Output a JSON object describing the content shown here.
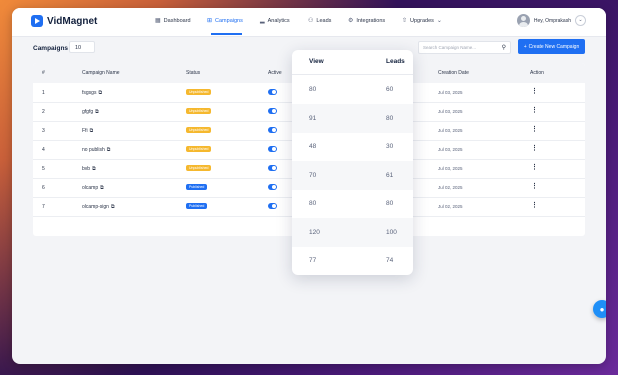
{
  "brand": {
    "name": "VidMagnet"
  },
  "nav": [
    {
      "label": "Dashboard",
      "icon": "grid-icon"
    },
    {
      "label": "Campaigns",
      "icon": "campaign-icon"
    },
    {
      "label": "Analytics",
      "icon": "bar-chart-icon"
    },
    {
      "label": "Leads",
      "icon": "users-icon"
    },
    {
      "label": "Integrations",
      "icon": "gear-icon"
    },
    {
      "label": "Upgrades",
      "icon": "upgrade-icon"
    }
  ],
  "user": {
    "greeting": "Hey, Omprakash"
  },
  "toolbar": {
    "title": "Campaigns",
    "count": "10",
    "search_placeholder": "Search Campaign Name...",
    "new_button": "Create New Campaign"
  },
  "table": {
    "headers": {
      "num": "#",
      "name": "Campaign Name",
      "status": "Status",
      "active": "Active",
      "created": "Creation Date",
      "action": "Action"
    },
    "rows": [
      {
        "num": "1",
        "name": "fsgsgs",
        "status": "Unpublished",
        "status_type": "unpublished",
        "active": true,
        "created": "Jul 03, 2025"
      },
      {
        "num": "2",
        "name": "gfgfg",
        "status": "Unpublished",
        "status_type": "unpublished",
        "active": true,
        "created": "Jul 03, 2025"
      },
      {
        "num": "3",
        "name": "Ffi",
        "status": "Unpublished",
        "status_type": "unpublished",
        "active": true,
        "created": "Jul 03, 2025"
      },
      {
        "num": "4",
        "name": "no publish",
        "status": "Unpublished",
        "status_type": "unpublished",
        "active": true,
        "created": "Jul 03, 2025"
      },
      {
        "num": "5",
        "name": "bvb",
        "status": "Unpublished",
        "status_type": "unpublished",
        "active": true,
        "created": "Jul 03, 2025"
      },
      {
        "num": "6",
        "name": "olcamp",
        "status": "Published",
        "status_type": "published",
        "active": true,
        "created": "Jul 02, 2025"
      },
      {
        "num": "7",
        "name": "olcamp-sign",
        "status": "Published",
        "status_type": "published",
        "active": true,
        "created": "Jul 02, 2025"
      }
    ]
  },
  "popup": {
    "headers": {
      "view": "View",
      "leads": "Leads"
    },
    "rows": [
      {
        "view": "80",
        "leads": "60"
      },
      {
        "view": "91",
        "leads": "80"
      },
      {
        "view": "48",
        "leads": "30"
      },
      {
        "view": "70",
        "leads": "61"
      },
      {
        "view": "80",
        "leads": "80"
      },
      {
        "view": "120",
        "leads": "100"
      },
      {
        "view": "77",
        "leads": "74"
      }
    ]
  },
  "colors": {
    "accent": "#1f6ff2",
    "unpublished": "#f5b82e",
    "published": "#1f6ff2"
  }
}
